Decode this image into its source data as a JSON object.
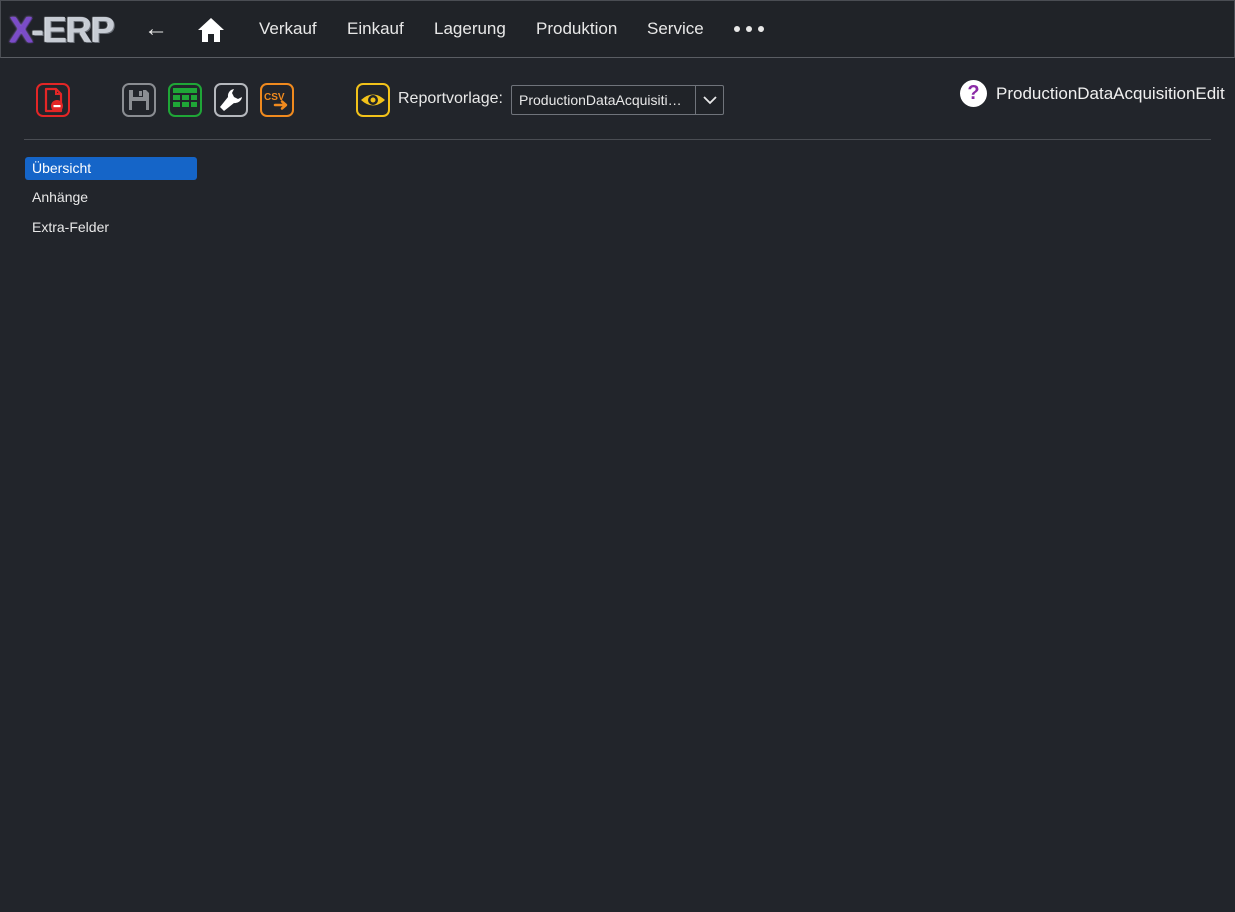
{
  "app": {
    "logo_x": "X",
    "logo_rest": "-ERP"
  },
  "topbar": {
    "back_label": "←",
    "nav_items": [
      "Verkauf",
      "Einkauf",
      "Lagerung",
      "Produktion",
      "Service"
    ]
  },
  "toolbar": {
    "report_label": "Reportvorlage:",
    "report_value": "ProductionDataAcquisitionEdit",
    "help_label": "?",
    "page_title": "ProductionDataAcquisitionEdit",
    "icons": [
      "delete-document-icon",
      "save-icon",
      "table-icon",
      "wrench-icon",
      "csv-export-icon",
      "eye-icon",
      "chevron-down-icon"
    ],
    "colors": {
      "delete": "#e32626",
      "save": "#8a8d92",
      "table": "#1fa637",
      "wrench": "#b5b8bd",
      "csv": "#f08a1e",
      "eye": "#f2c21a"
    }
  },
  "sidebar": {
    "items": [
      {
        "label": "Übersicht",
        "active": true
      },
      {
        "label": "Anhänge",
        "active": false
      },
      {
        "label": "Extra-Felder",
        "active": false
      }
    ],
    "active_color": "#1565c8"
  }
}
